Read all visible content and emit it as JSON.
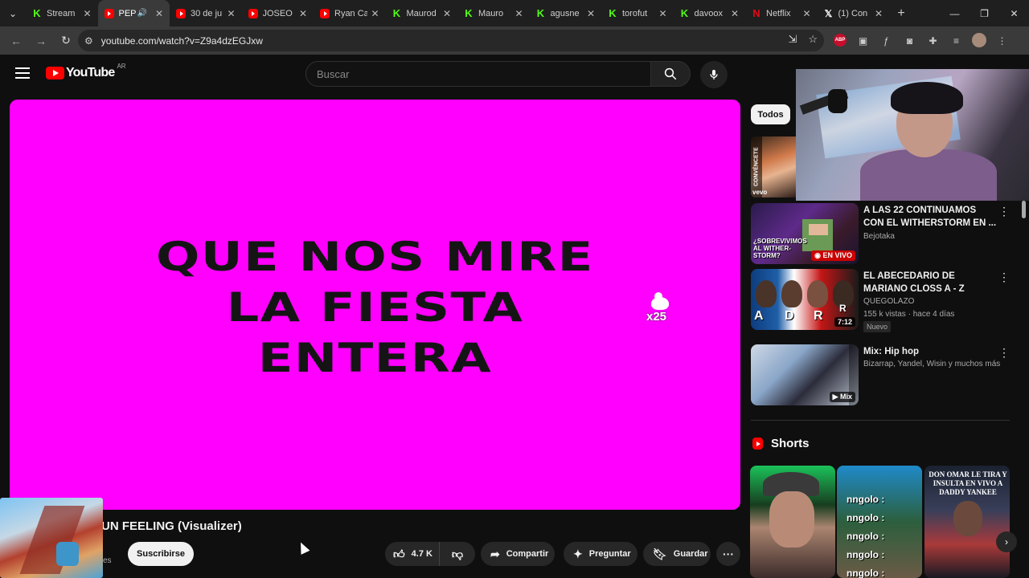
{
  "browser": {
    "tabs": [
      {
        "label": "Stream",
        "favicon": "kick-icon",
        "active": false
      },
      {
        "label": "PEP",
        "favicon": "youtube-icon",
        "active": true,
        "audio": true
      },
      {
        "label": "30 de ju",
        "favicon": "youtube-icon",
        "active": false
      },
      {
        "label": "JOSEO",
        "favicon": "youtube-icon",
        "active": false
      },
      {
        "label": "Ryan Ca",
        "favicon": "youtube-icon",
        "active": false
      },
      {
        "label": "Maurod",
        "favicon": "kick-icon",
        "active": false
      },
      {
        "label": "Mauro",
        "favicon": "kick-icon",
        "active": false
      },
      {
        "label": "agusne",
        "favicon": "kick-icon",
        "active": false
      },
      {
        "label": "torofut",
        "favicon": "kick-icon",
        "active": false
      },
      {
        "label": "davoox",
        "favicon": "kick-icon",
        "active": false
      },
      {
        "label": "Netflix",
        "favicon": "netflix-icon",
        "active": false
      },
      {
        "label": "(1) Con",
        "favicon": "x-icon",
        "active": false
      }
    ],
    "url": "youtube.com/watch?v=Z9a4dzEGJxw"
  },
  "youtube": {
    "logo_text": "YouTube",
    "country_code": "AR",
    "search_placeholder": "Buscar"
  },
  "player": {
    "lyrics": [
      "QUE NOS MIRE",
      "LA FIESTA",
      "ENTERA"
    ],
    "overlay_badge": "x25"
  },
  "video": {
    "title": "UN FEELING (Visualizer)",
    "subscriber_fragment": "es",
    "subscribe_label": "Suscribirse",
    "likes": "4.7 K",
    "share_label": "Compartir",
    "ask_label": "Preguntar",
    "save_label": "Guardar"
  },
  "sidebar": {
    "chip_all": "Todos",
    "first_thumb_label": "CONVÉNCETE",
    "first_thumb_brand": "vevo",
    "recommendations": [
      {
        "title": "A LAS 22 CONTINUAMOS CON EL WITHERSTORM EN ...",
        "channel": "Bejotaka",
        "meta": "",
        "badge": "EN VIVO",
        "thumb_caption": "¿SOBREVIVIMOS AL WITHER-STORM?"
      },
      {
        "title": "EL ABECEDARIO DE MARIANO CLOSS A - Z",
        "channel": "QUEGOLAZO",
        "meta": "155 k vistas · hace 4 días",
        "badge": "7:12",
        "tag": "Nuevo",
        "thumb_letters": [
          "A",
          "D",
          "R",
          "R"
        ]
      },
      {
        "title": "Mix: Hip hop",
        "channel": "Bizarrap, Yandel, Wisin y muchos más",
        "meta": "",
        "badge": "Mix"
      }
    ],
    "shorts_title": "Shorts",
    "shorts": [
      {
        "caption": ""
      },
      {
        "rows": [
          "nngolo :",
          "nngolo :",
          "nngolo :",
          "nngolo :",
          "nngolo :"
        ]
      },
      {
        "caption": "DON OMAR LE TIRA Y INSULTA EN VIVO A DADDY YANKEE"
      }
    ]
  },
  "colors": {
    "player_bg": "#ff00ff",
    "brand_red": "#ff0000",
    "kick_green": "#53fc18",
    "page_bg": "#0f0f0f"
  }
}
